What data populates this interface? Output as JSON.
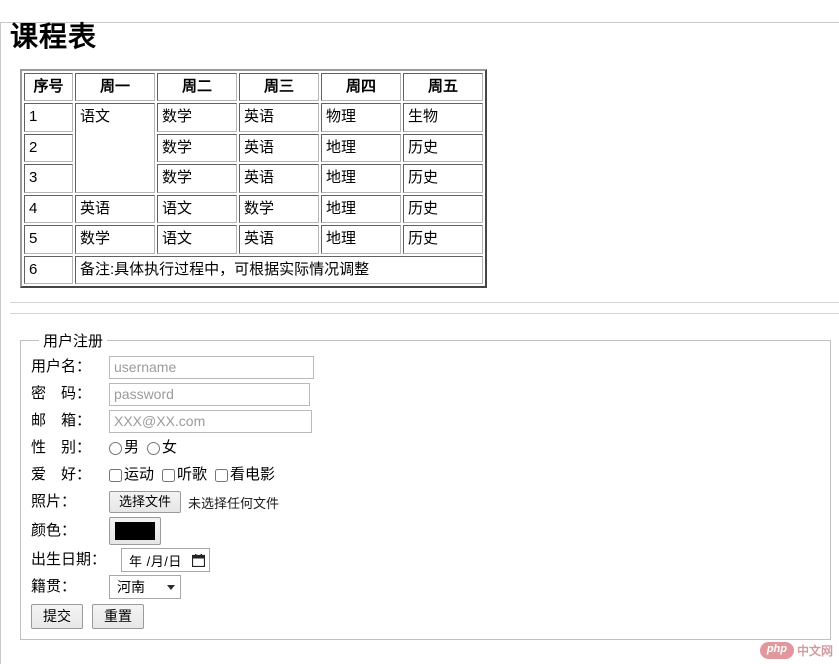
{
  "page": {
    "title": "课程表"
  },
  "timetable": {
    "headers": [
      "序号",
      "周一",
      "周二",
      "周三",
      "周四",
      "周五"
    ],
    "rows": [
      {
        "index": "1",
        "mon": "",
        "tue": "数学",
        "wed": "英语",
        "thu": "物理",
        "fri": "生物"
      },
      {
        "index": "2",
        "mon": "语文",
        "tue": "数学",
        "wed": "英语",
        "thu": "地理",
        "fri": "历史"
      },
      {
        "index": "3",
        "mon": "",
        "tue": "数学",
        "wed": "英语",
        "thu": "地理",
        "fri": "历史"
      },
      {
        "index": "4",
        "mon": "英语",
        "tue": "语文",
        "wed": "数学",
        "thu": "地理",
        "fri": "历史"
      },
      {
        "index": "5",
        "mon": "数学",
        "tue": "语文",
        "wed": "英语",
        "thu": "地理",
        "fri": "历史"
      }
    ],
    "footer": {
      "index": "6",
      "note": "备注:具体执行过程中，可根据实际情况调整"
    }
  },
  "form": {
    "legend": "用户注册",
    "username": {
      "label": "用户名：",
      "placeholder": "username",
      "value": ""
    },
    "password": {
      "label": "密　码：",
      "placeholder": "password",
      "value": ""
    },
    "email": {
      "label": "邮　箱：",
      "placeholder": "XXX@XX.com",
      "value": ""
    },
    "gender": {
      "label": "性　别：",
      "options": [
        {
          "label": "男",
          "checked": false
        },
        {
          "label": "女",
          "checked": false
        }
      ]
    },
    "hobby": {
      "label": "爱　好：",
      "options": [
        {
          "label": "运动",
          "checked": false
        },
        {
          "label": "听歌",
          "checked": false
        },
        {
          "label": "看电影",
          "checked": false
        }
      ]
    },
    "photo": {
      "label": "照片：",
      "button_label": "选择文件",
      "status": "未选择任何文件"
    },
    "color": {
      "label": "颜色：",
      "value": "#000000"
    },
    "birthday": {
      "label": "出生日期：",
      "value": "年 /月/日",
      "icon": "calendar-icon"
    },
    "hometown": {
      "label": "籍贯：",
      "selected": "河南",
      "icon": "chevron-down-icon"
    },
    "submit_label": "提交",
    "reset_label": "重置"
  },
  "watermark": {
    "badge": "php",
    "text": "中文网"
  }
}
